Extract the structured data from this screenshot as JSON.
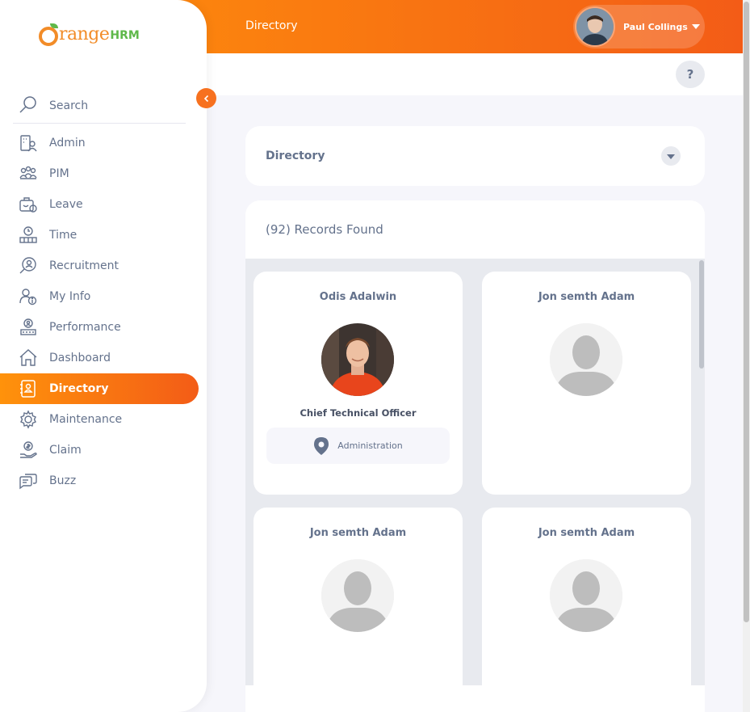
{
  "brand": {
    "name_part1": "range",
    "name_part2": "HRM"
  },
  "header": {
    "title": "Directory",
    "user_name": "Paul Collings",
    "help_label": "?"
  },
  "sidebar": {
    "search_label": "Search",
    "items": [
      {
        "label": "Admin",
        "icon": "admin-icon"
      },
      {
        "label": "PIM",
        "icon": "pim-icon"
      },
      {
        "label": "Leave",
        "icon": "leave-icon"
      },
      {
        "label": "Time",
        "icon": "time-icon"
      },
      {
        "label": "Recruitment",
        "icon": "recruitment-icon"
      },
      {
        "label": "My Info",
        "icon": "my-info-icon"
      },
      {
        "label": "Performance",
        "icon": "performance-icon"
      },
      {
        "label": "Dashboard",
        "icon": "dashboard-icon"
      },
      {
        "label": "Directory",
        "icon": "directory-icon",
        "active": true
      },
      {
        "label": "Maintenance",
        "icon": "maintenance-icon"
      },
      {
        "label": "Claim",
        "icon": "claim-icon"
      },
      {
        "label": "Buzz",
        "icon": "buzz-icon"
      }
    ]
  },
  "filter": {
    "title": "Directory"
  },
  "results": {
    "count_text": "(92) Records Found",
    "cards": [
      {
        "name": "Odis Adalwin",
        "job_title": "Chief Technical Officer",
        "location": "Administration",
        "has_photo": true
      },
      {
        "name": "Jon semth Adam",
        "has_photo": false
      },
      {
        "name": "Jon semth Adam",
        "has_photo": false
      },
      {
        "name": "Jon semth Adam",
        "has_photo": false
      }
    ]
  },
  "colors": {
    "accent_start": "#ff920b",
    "accent_end": "#f35c17",
    "text": "#64728c",
    "brand_green": "#5fb84a"
  }
}
